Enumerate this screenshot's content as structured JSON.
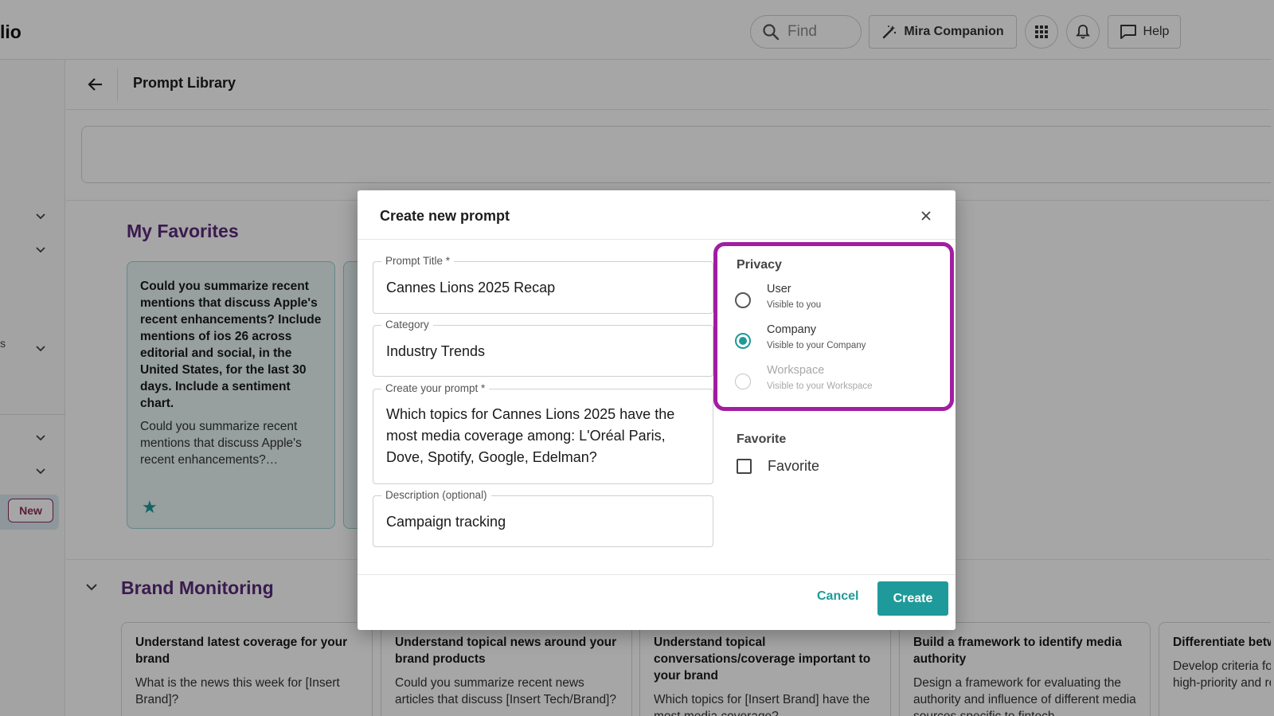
{
  "app": {
    "name_fragment": "lio"
  },
  "topbar": {
    "find_placeholder": "Find",
    "mira_label": "Mira Companion",
    "help_label": "Help"
  },
  "sidebar": {
    "text_fragment": "s",
    "new_badge": "New"
  },
  "page": {
    "title": "Prompt Library"
  },
  "favorites": {
    "title": "My Favorites",
    "card": {
      "question": "Could you summarize recent mentions that discuss Apple's recent enhancements? Include mentions of ios 26 across editorial and social, in the United States, for the last 30 days. Include a sentiment chart.",
      "description": "Could you summarize recent mentions that discuss Apple's recent enhancements?…"
    }
  },
  "brand_monitoring": {
    "title": "Brand Monitoring",
    "cards": [
      {
        "title": "Understand latest coverage for your brand",
        "description": "What is the news this week for [Insert Brand]?"
      },
      {
        "title": "Understand topical news around your brand products",
        "description": "Could you summarize recent news articles that discuss [Insert Tech/Brand]?"
      },
      {
        "title": "Understand topical conversations/coverage important to your brand",
        "description": "Which topics for [Insert Brand] have the most media coverage?"
      },
      {
        "title": "Build a framework to identify media authority",
        "description": "Design a framework for evaluating the authority and influence of different media sources specific to fintech."
      },
      {
        "title": "Differentiate between routine coverage",
        "description": "Develop criteria for distinguishing between high-priority and routine coverage."
      }
    ]
  },
  "modal": {
    "title": "Create new prompt",
    "fields": {
      "title_label": "Prompt Title *",
      "title_value": "Cannes Lions 2025 Recap",
      "category_label": "Category",
      "category_value": "Industry Trends",
      "prompt_label": "Create your prompt *",
      "prompt_value": "Which topics for Cannes Lions 2025 have the most media coverage among: L'Oréal Paris, Dove, Spotify, Google, Edelman?",
      "description_label": "Description (optional)",
      "description_value": "Campaign tracking"
    },
    "privacy": {
      "title": "Privacy",
      "options": [
        {
          "label": "User",
          "sub": "Visible to you",
          "selected": false,
          "disabled": false
        },
        {
          "label": "Company",
          "sub": "Visible to your Company",
          "selected": true,
          "disabled": false
        },
        {
          "label": "Workspace",
          "sub": "Visible to your Workspace",
          "selected": false,
          "disabled": true
        }
      ]
    },
    "favorite": {
      "title": "Favorite",
      "checkbox_label": "Favorite",
      "checked": false
    },
    "cancel_label": "Cancel",
    "create_label": "Create"
  },
  "colors": {
    "accent": "#1f9a9a",
    "highlight_border": "#a11ea1",
    "section_title": "#5a2a7a",
    "badge": "#8b2c5b"
  }
}
